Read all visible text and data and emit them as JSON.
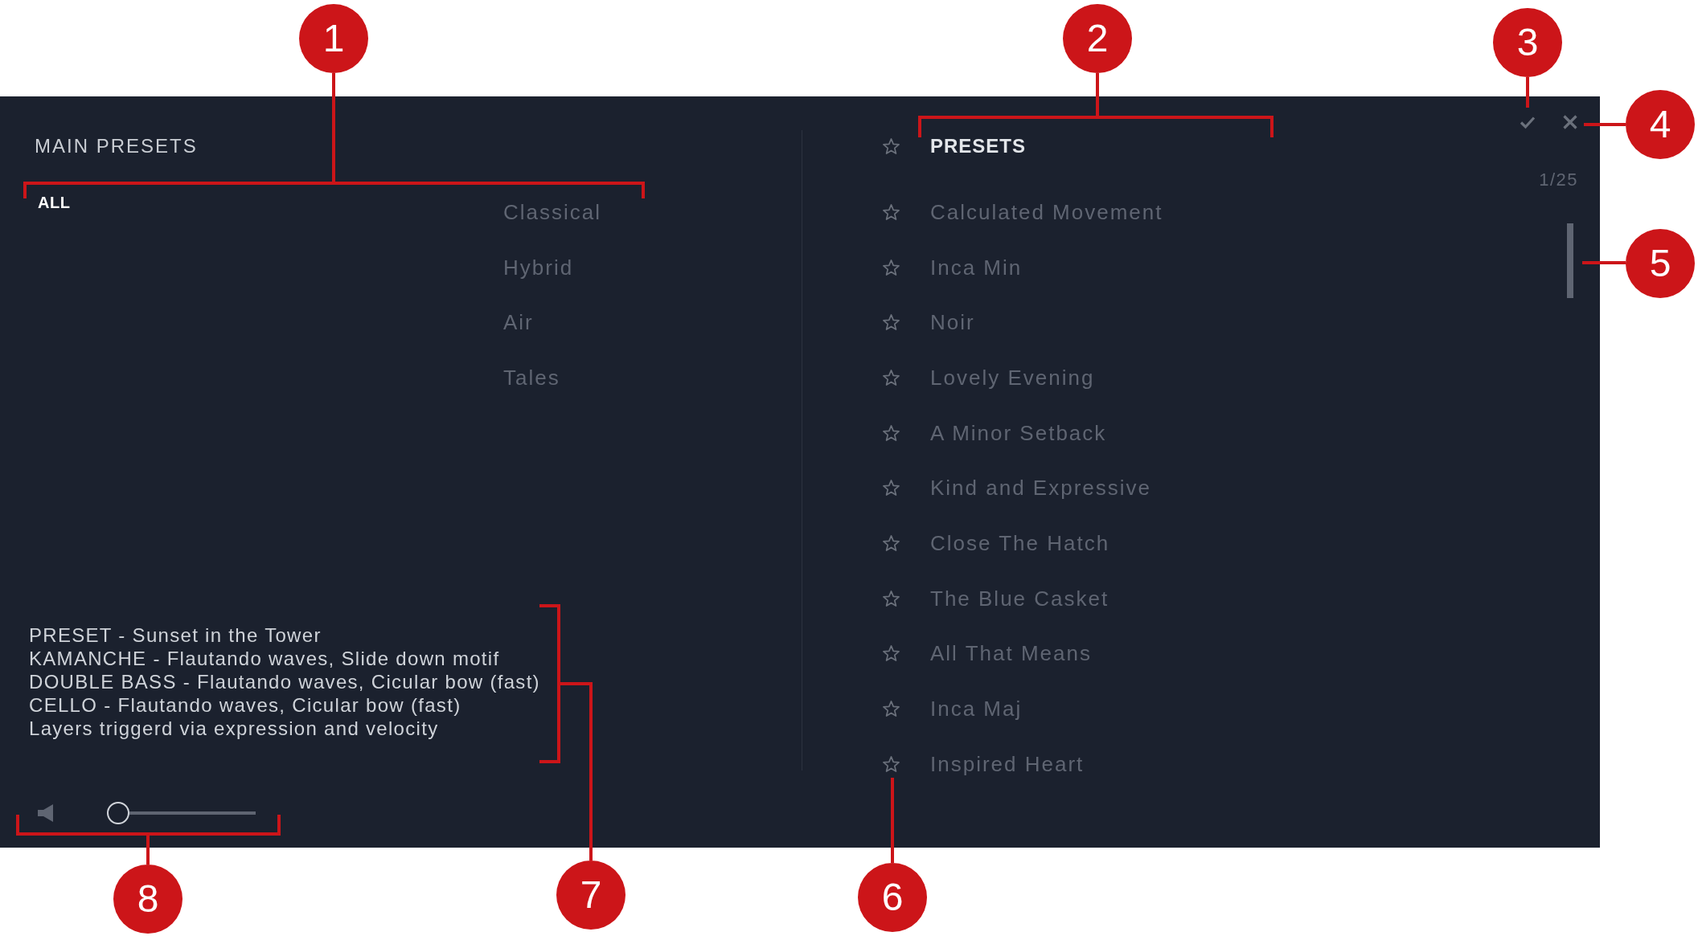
{
  "main_presets": {
    "title": "MAIN PRESETS",
    "banks": [
      {
        "label": "ALL",
        "selected": true
      }
    ],
    "categories": [
      {
        "label": "Classical",
        "selected": false
      },
      {
        "label": "Hybrid",
        "selected": false
      },
      {
        "label": "Air",
        "selected": false
      },
      {
        "label": "Tales",
        "selected": false
      }
    ]
  },
  "preset_info": {
    "lines": [
      "PRESET - Sunset in the Tower",
      "KAMANCHE - Flautando waves, Slide down motif",
      "DOUBLE BASS - Flautando waves, Cicular bow (fast)",
      "CELLO - Flautando waves, Cicular bow (fast)",
      "Layers triggerd via expression and velocity"
    ]
  },
  "volume": {
    "level": 0
  },
  "presets": {
    "favorites_only": false,
    "title": "PRESETS",
    "counter": "1/25",
    "items": [
      {
        "name": "Calculated Movement",
        "favorite": false,
        "selected": false
      },
      {
        "name": "Inca Min",
        "favorite": false,
        "selected": false
      },
      {
        "name": "Noir",
        "favorite": false,
        "selected": false
      },
      {
        "name": "Lovely Evening",
        "favorite": false,
        "selected": false
      },
      {
        "name": "A Minor Setback",
        "favorite": false,
        "selected": false
      },
      {
        "name": "Kind and Expressive",
        "favorite": false,
        "selected": false
      },
      {
        "name": "Close The Hatch",
        "favorite": false,
        "selected": false
      },
      {
        "name": "The Blue Casket",
        "favorite": false,
        "selected": false
      },
      {
        "name": "All That Means",
        "favorite": false,
        "selected": false
      },
      {
        "name": "Inca Maj",
        "favorite": false,
        "selected": false
      },
      {
        "name": "Inspired Heart",
        "favorite": false,
        "selected": false
      }
    ]
  },
  "callouts": [
    {
      "label": "1"
    },
    {
      "label": "2"
    },
    {
      "label": "3"
    },
    {
      "label": "4"
    },
    {
      "label": "5"
    },
    {
      "label": "8"
    },
    {
      "label": "7"
    },
    {
      "label": "6"
    }
  ]
}
